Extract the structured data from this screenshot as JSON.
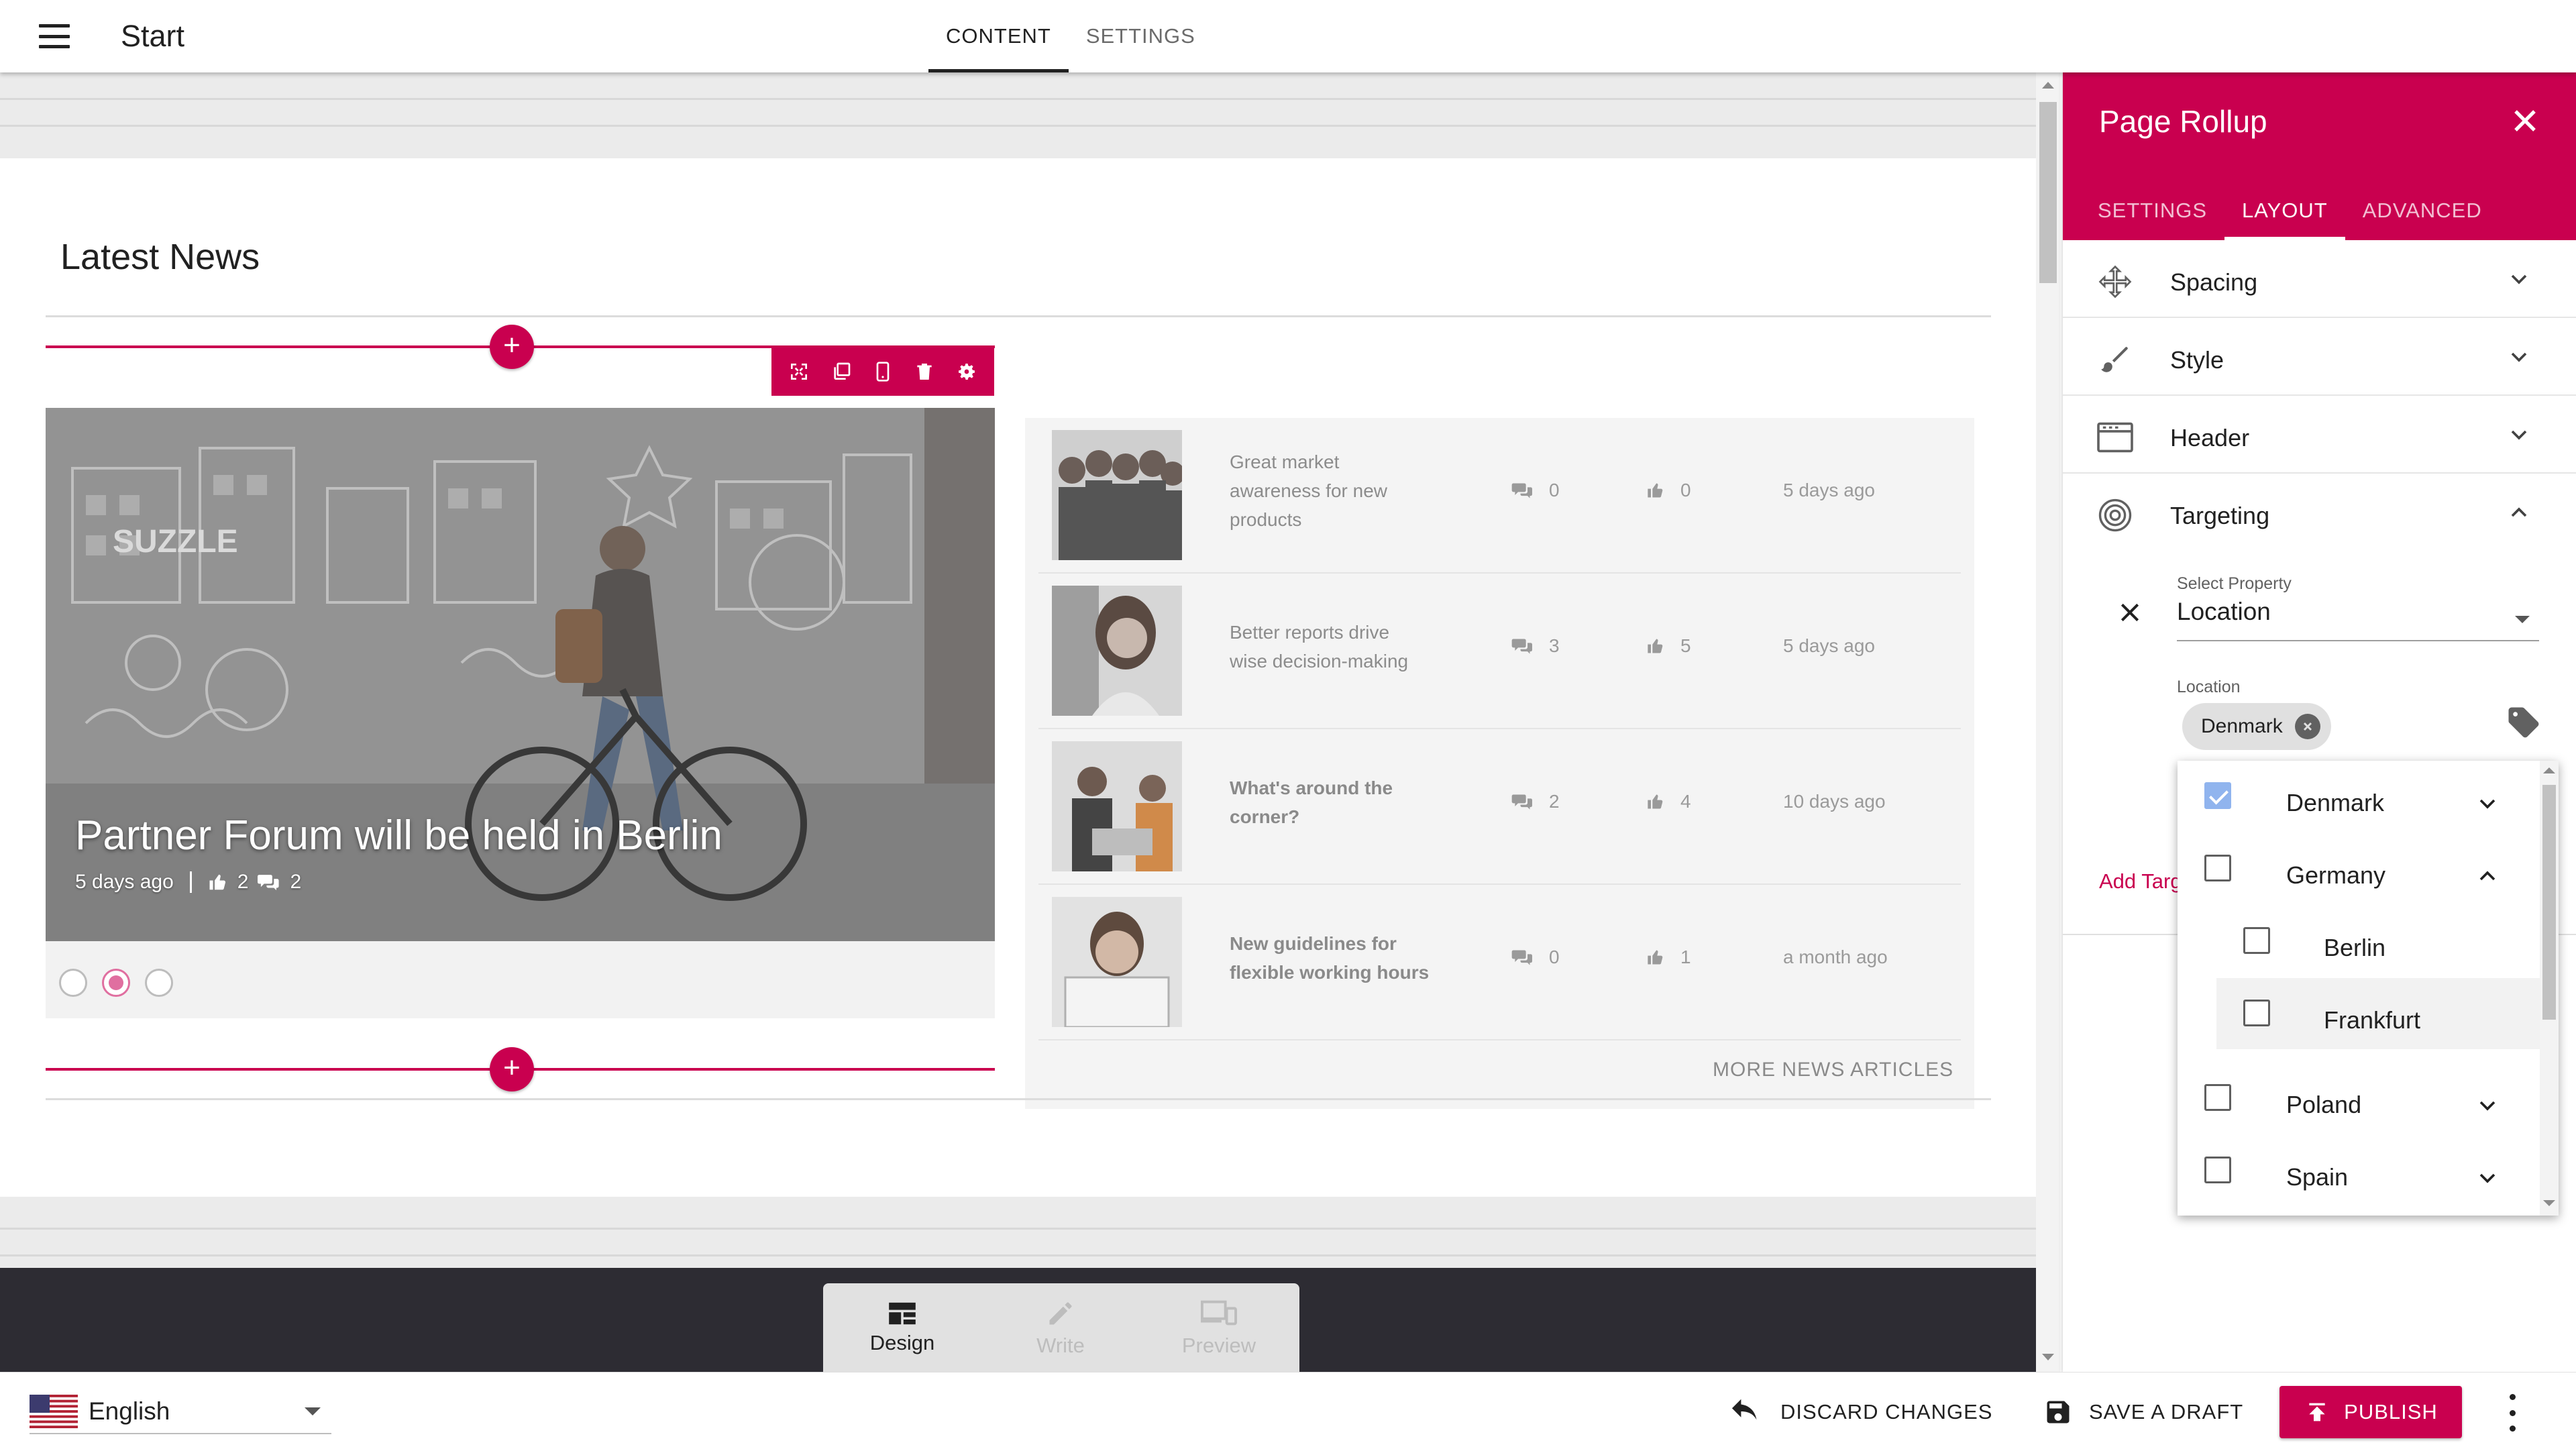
{
  "app": {
    "title": "Start",
    "tabs": [
      {
        "label": "CONTENT",
        "active": true
      },
      {
        "label": "SETTINGS",
        "active": false
      }
    ]
  },
  "page": {
    "section_title": "Latest News",
    "featured": {
      "title": "Partner Forum will be held in Berlin",
      "date": "5 days ago",
      "likes": "2",
      "comments": "2",
      "slides": 3,
      "active_slide": 2
    },
    "news": [
      {
        "title": "Great market awareness for new products",
        "comments": "0",
        "likes": "0",
        "date": "5 days ago",
        "bold": false
      },
      {
        "title": "Better reports drive wise decision-making",
        "comments": "3",
        "likes": "5",
        "date": "5 days ago",
        "bold": false
      },
      {
        "title": "What's around the corner?",
        "comments": "2",
        "likes": "4",
        "date": "10 days ago",
        "bold": true
      },
      {
        "title": "New guidelines for flexible working hours",
        "comments": "0",
        "likes": "1",
        "date": "a month ago",
        "bold": true
      }
    ],
    "more_news_label": "MORE NEWS ARTICLES"
  },
  "modes": [
    {
      "label": "Design",
      "icon": "dashboard-icon",
      "active": true
    },
    {
      "label": "Write",
      "icon": "pencil-icon",
      "active": false
    },
    {
      "label": "Preview",
      "icon": "devices-icon",
      "active": false
    }
  ],
  "footer": {
    "language": "English",
    "flag": "us-flag-icon",
    "discard_label": "DISCARD CHANGES",
    "draft_label": "SAVE A DRAFT",
    "publish_label": "PUBLISH"
  },
  "panel": {
    "title": "Page Rollup",
    "tabs": [
      {
        "label": "SETTINGS",
        "active": false
      },
      {
        "label": "LAYOUT",
        "active": true
      },
      {
        "label": "ADVANCED",
        "active": false
      }
    ],
    "sections": [
      {
        "label": "Spacing",
        "icon": "move-icon",
        "expanded": false
      },
      {
        "label": "Style",
        "icon": "brush-icon",
        "expanded": false
      },
      {
        "label": "Header",
        "icon": "header-icon",
        "expanded": false
      },
      {
        "label": "Targeting",
        "icon": "target-icon",
        "expanded": true
      }
    ],
    "targeting": {
      "select_property_label": "Select Property",
      "select_property_value": "Location",
      "location_label": "Location",
      "selected_chip": "Denmark",
      "add_target_label": "Add Targ"
    },
    "dropdown": [
      {
        "label": "Denmark",
        "checked": true,
        "level": 0,
        "expander": "down"
      },
      {
        "label": "Germany",
        "checked": false,
        "level": 0,
        "expander": "up"
      },
      {
        "label": "Berlin",
        "checked": false,
        "level": 1,
        "expander": null
      },
      {
        "label": "Frankfurt",
        "checked": false,
        "level": 1,
        "expander": null
      },
      {
        "label": "Poland",
        "checked": false,
        "level": 0,
        "expander": "down"
      },
      {
        "label": "Spain",
        "checked": false,
        "level": 0,
        "expander": "down"
      }
    ]
  },
  "colors": {
    "accent": "#c9004f",
    "mode_bar": "#2d2c33",
    "checkbox_checked": "#90b4ee"
  }
}
